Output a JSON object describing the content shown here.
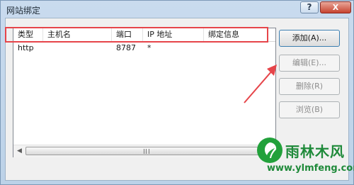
{
  "window": {
    "title": "网站绑定",
    "help_label": "?",
    "close_label": "X"
  },
  "listview": {
    "columns": [
      "类型",
      "主机名",
      "端口",
      "IP 地址",
      "绑定信息"
    ],
    "rows": [
      {
        "type": "http",
        "host": "",
        "port": "8787",
        "ip": "*",
        "binding": ""
      }
    ],
    "scroll_left": "◀",
    "scroll_right": "▶"
  },
  "buttons": {
    "add": "添加(A)...",
    "edit": "编辑(E)...",
    "remove": "删除(R)",
    "browse": "浏览(B)"
  },
  "colors": {
    "highlight": "#e6454a",
    "watermark": "#1f8a3a"
  },
  "watermark": {
    "brand": "雨林木风",
    "url": "www.ylmfeng.com"
  }
}
